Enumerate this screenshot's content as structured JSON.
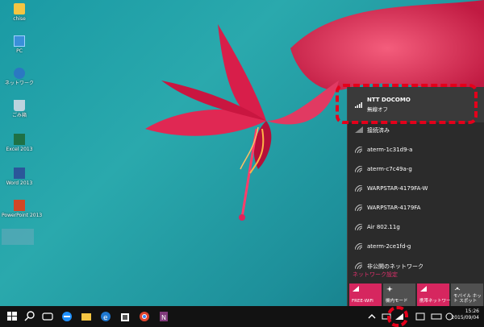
{
  "desktop": {
    "icons": [
      {
        "label": "chise",
        "icon": "user-folder-icon"
      },
      {
        "label": "PC",
        "icon": "pc-icon"
      },
      {
        "label": "ネットワーク",
        "icon": "network-icon"
      },
      {
        "label": "ごみ箱",
        "icon": "recycle-bin-icon"
      },
      {
        "label": "Excel 2013",
        "icon": "excel-icon"
      },
      {
        "label": "Word 2013",
        "icon": "word-icon"
      },
      {
        "label": "PowerPoint 2013",
        "icon": "powerpoint-icon"
      }
    ]
  },
  "network_flyout": {
    "current": {
      "name": "NTT DOCOMO",
      "status": "無線オフ"
    },
    "connected_label": "接続済み",
    "networks": [
      "aterm-1c31d9-a",
      "aterm-c7c49a-g",
      "WARPSTAR-4179FA-W",
      "WARPSTAR-4179FA",
      "Air 802.11g",
      "aterm-2ce1fd-g",
      "非公開のネットワーク"
    ],
    "settings_link": "ネットワーク設定",
    "quick_actions": [
      {
        "label": "FREE-WiFi",
        "active": true
      },
      {
        "label": "機内モード",
        "active": false
      },
      {
        "label": "携帯ネットワーク",
        "active": true
      },
      {
        "label": "モバイル ホット スポット",
        "active": false
      }
    ]
  },
  "taskbar": {
    "time": "15:26",
    "date": "2015/09/04"
  },
  "colors": {
    "accent": "#d6265f",
    "highlight": "#e4001b",
    "flyout_bg": "#2b2b2b",
    "taskbar_bg": "#121212"
  }
}
